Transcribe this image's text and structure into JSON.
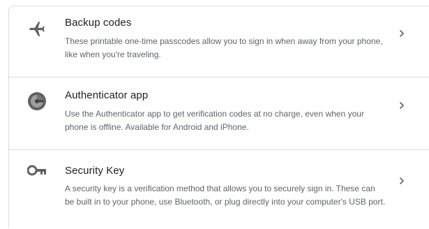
{
  "options": [
    {
      "icon": "airplane-icon",
      "title": "Backup codes",
      "description": "These printable one-time passcodes allow you to sign in when away from your phone, like when you're traveling."
    },
    {
      "icon": "authenticator-app-icon",
      "title": "Authenticator app",
      "description": "Use the Authenticator app to get verification codes at no charge, even when your phone is offline. Available for Android and iPhone."
    },
    {
      "icon": "security-key-icon",
      "title": "Security Key",
      "description": "A security key is a verification method that allows you to securely sign in. These can be built in to your phone, use Bluetooth, or plug directly into your computer's USB port."
    }
  ],
  "colors": {
    "icon": "#5f6368",
    "text_primary": "#202124",
    "text_secondary": "#5f6368",
    "divider": "#dadce0"
  }
}
